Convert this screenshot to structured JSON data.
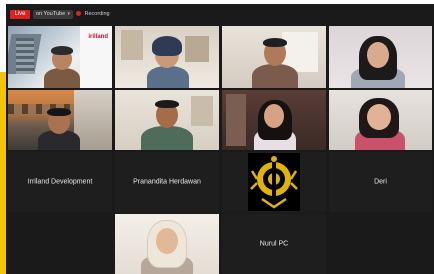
{
  "topbar": {
    "live_label": "Live",
    "stream_label": "on YouTube",
    "recording_label": "Recording"
  },
  "participants": [
    {
      "name": "",
      "video": true,
      "logo_text": "irilland"
    },
    {
      "name": "",
      "video": true
    },
    {
      "name": "",
      "video": true
    },
    {
      "name": "",
      "video": true
    },
    {
      "name": "",
      "video": true
    },
    {
      "name": "",
      "video": true
    },
    {
      "name": "",
      "video": true
    },
    {
      "name": "",
      "video": true
    },
    {
      "name": "Irriland Development",
      "video": false
    },
    {
      "name": "Pranandita Herdawan",
      "video": false
    },
    {
      "name": "",
      "video": true,
      "image": "university-emblem"
    },
    {
      "name": "Deri",
      "video": false
    },
    {
      "name": "",
      "video": true
    },
    {
      "name": "Nurul PC",
      "video": false
    }
  ],
  "colors": {
    "accent_gold": "#f2c500",
    "live_red": "#e02020",
    "tile_bg": "#1e1e1e",
    "emblem_gold": "#e0b400"
  }
}
